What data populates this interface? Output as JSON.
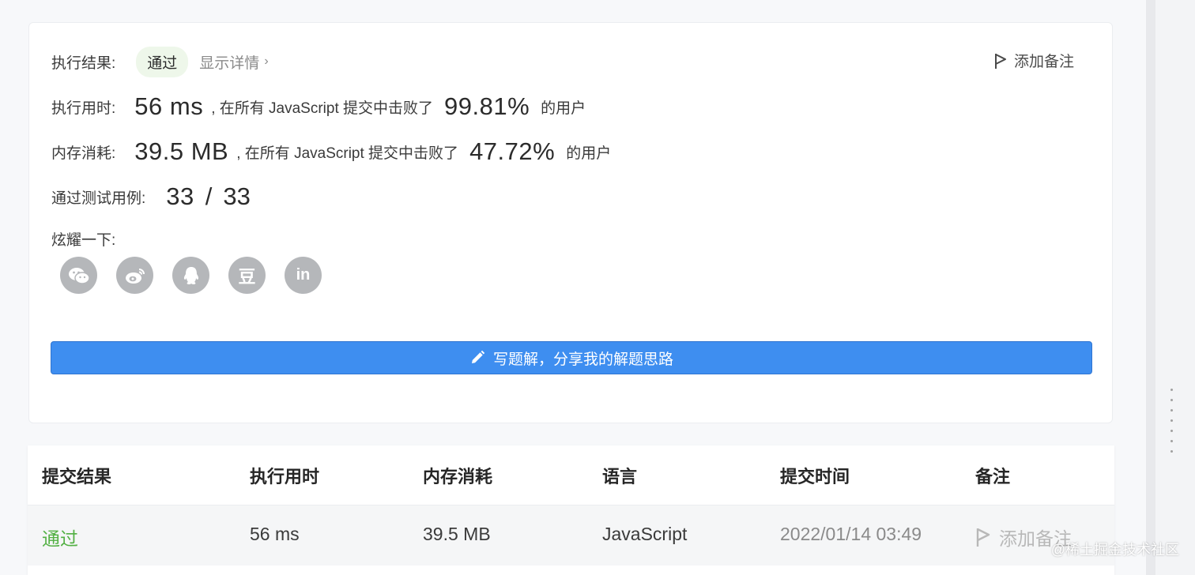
{
  "result": {
    "label": "执行结果:",
    "status": "通过",
    "details_link": "显示详情",
    "add_note": "添加备注"
  },
  "runtime": {
    "label": "执行用时:",
    "value": "56 ms",
    "beat_text": ", 在所有 JavaScript 提交中击败了",
    "percent": "99.81%",
    "suffix": "的用户"
  },
  "memory": {
    "label": "内存消耗:",
    "value": "39.5 MB",
    "beat_text": ", 在所有 JavaScript 提交中击败了",
    "percent": "47.72%",
    "suffix": "的用户"
  },
  "testcases": {
    "label": "通过测试用例:",
    "passed": "33",
    "separator": "/",
    "total": "33"
  },
  "share": {
    "label": "炫耀一下:",
    "icons": [
      "wechat-icon",
      "weibo-icon",
      "qq-icon",
      "douban-icon",
      "linkedin-icon"
    ],
    "douban_glyph": "豆",
    "linkedin_glyph": "in"
  },
  "write_solution_button": "写题解，分享我的解题思路",
  "table": {
    "headers": [
      "提交结果",
      "执行用时",
      "内存消耗",
      "语言",
      "提交时间",
      "备注"
    ],
    "rows": [
      {
        "result": "通过",
        "runtime": "56 ms",
        "memory": "39.5 MB",
        "language": "JavaScript",
        "time": "2022/01/14 03:49",
        "note": "添加备注"
      }
    ]
  },
  "watermark": "@稀土掘金技术社区",
  "colors": {
    "accent": "#3e8ef0",
    "pass_green": "#52b043",
    "badge_bg": "#eef7ea",
    "icon_gray": "#b5b7ba"
  }
}
